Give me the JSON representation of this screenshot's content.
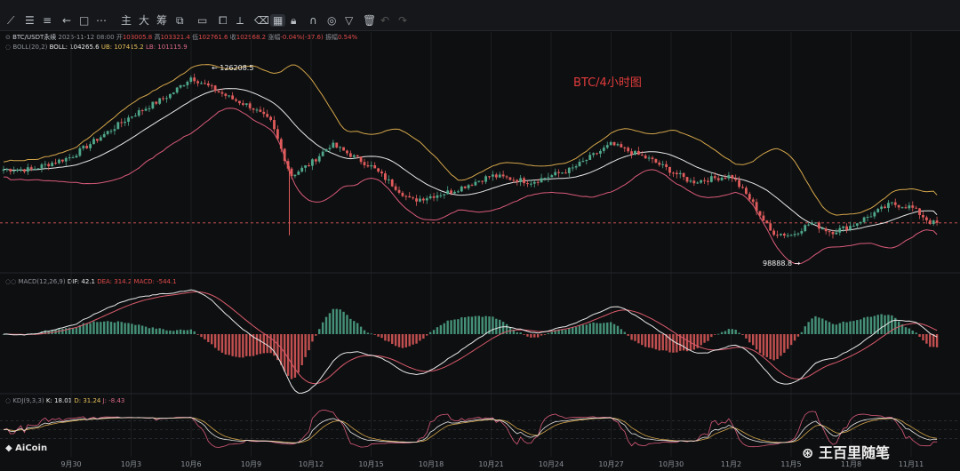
{
  "toolbar": {
    "tools": [
      "line-tool-icon",
      "hline-tool-icon",
      "fib-tool-icon",
      "arrow-left-icon",
      "rect-tool-icon",
      "more-tools-icon",
      "主",
      "大",
      "筹",
      "compare-icon",
      "layers-icon",
      "ruler-icon",
      "eraser-icon",
      "grid-icon",
      "lock-icon",
      "magnet-icon",
      "eye-icon",
      "trash-icon",
      "undo-icon",
      "redo-icon"
    ]
  },
  "header": {
    "symbol": "BTC/USDT永续",
    "datetime": "2025-11-12 08:00",
    "open_label": "开",
    "open": "103005.8",
    "high_label": "高",
    "high": "103321.4",
    "low_label": "低",
    "low": "102761.6",
    "close_label": "收",
    "close": "102968.2",
    "change_label": "涨幅",
    "change": "-0.04%(-37.6)",
    "amp_label": "振幅",
    "amp": "0.54%"
  },
  "boll": {
    "label": "BOLL(20,2)",
    "mid": "BOLL: 104265.6",
    "ub": "UB: 107415.2",
    "lb": "LB: 101115.9"
  },
  "macd": {
    "label": "MACD(12,26,9)",
    "dif": "DIF: 42.1",
    "dea": "DEA: 314.2",
    "macd": "MACD: -544.1"
  },
  "kdj": {
    "label": "KDJ(9,3,3)",
    "k": "K: 18.01",
    "d": "D: 31.24",
    "j": "J: -8.43"
  },
  "annotations": {
    "title": "BTC/4小时图",
    "high_marker": "126208.5",
    "low_marker": "98888.8"
  },
  "branding": {
    "logo": "AiCoin",
    "watermark": "王百里随笔"
  },
  "colors": {
    "up": "#4fa88a",
    "down": "#e05b5b",
    "boll_mid": "#e8e8e8",
    "boll_ub": "#d4a64a",
    "boll_lb": "#d95b7a",
    "dif": "#e8e8e8",
    "dea": "#d95b6b"
  },
  "chart_data": {
    "type": "line",
    "title": "BTC/4小时图",
    "x_tick_labels": [
      "9月30",
      "10月3",
      "10月6",
      "10月9",
      "10月12",
      "10月15",
      "10月18",
      "10月21",
      "10月24",
      "10月27",
      "10月30",
      "11月2",
      "11月5",
      "11月8",
      "11月11"
    ],
    "price_anchors": [
      {
        "date": "9月28",
        "close": 111500
      },
      {
        "date": "9月30",
        "close": 113500
      },
      {
        "date": "10月3",
        "close": 120000
      },
      {
        "date": "10月5",
        "close": 123500
      },
      {
        "date": "10月6",
        "close": 126208.5
      },
      {
        "date": "10月8",
        "close": 122800
      },
      {
        "date": "10月9",
        "close": 121500
      },
      {
        "date": "10月10",
        "close": 119000
      },
      {
        "date": "10月11",
        "close": 110500
      },
      {
        "date": "10月12",
        "close": 112500
      },
      {
        "date": "10月13",
        "close": 115500
      },
      {
        "date": "10月15",
        "close": 112000
      },
      {
        "date": "10月17",
        "close": 106500
      },
      {
        "date": "10月19",
        "close": 108000
      },
      {
        "date": "10月21",
        "close": 110500
      },
      {
        "date": "10月23",
        "close": 109500
      },
      {
        "date": "10月25",
        "close": 111500
      },
      {
        "date": "10月27",
        "close": 115500
      },
      {
        "date": "10月29",
        "close": 113000
      },
      {
        "date": "10月31",
        "close": 109500
      },
      {
        "date": "11月2",
        "close": 110500
      },
      {
        "date": "11月3",
        "close": 106500
      },
      {
        "date": "11月4",
        "close": 101500
      },
      {
        "date": "11月5",
        "close": 101000
      },
      {
        "date": "11月6",
        "close": 103000
      },
      {
        "date": "11月7",
        "close": 101500
      },
      {
        "date": "11月8",
        "close": 102500
      },
      {
        "date": "11月10",
        "close": 106000
      },
      {
        "date": "11月11",
        "close": 105500
      },
      {
        "date": "11月12",
        "close": 102968.2
      }
    ],
    "series": [
      {
        "name": "BOLL",
        "last": 104265.6
      },
      {
        "name": "UB",
        "last": 107415.2
      },
      {
        "name": "LB",
        "last": 101115.9
      },
      {
        "name": "DIF",
        "last": 42.1
      },
      {
        "name": "DEA",
        "last": 314.2
      },
      {
        "name": "MACD",
        "last": -544.1
      },
      {
        "name": "K",
        "last": 18.01
      },
      {
        "name": "D",
        "last": 31.24
      },
      {
        "name": "J",
        "last": -8.43
      }
    ],
    "high_marker": 126208.5,
    "low_marker": 98888.8,
    "current_close": 102968.2
  }
}
